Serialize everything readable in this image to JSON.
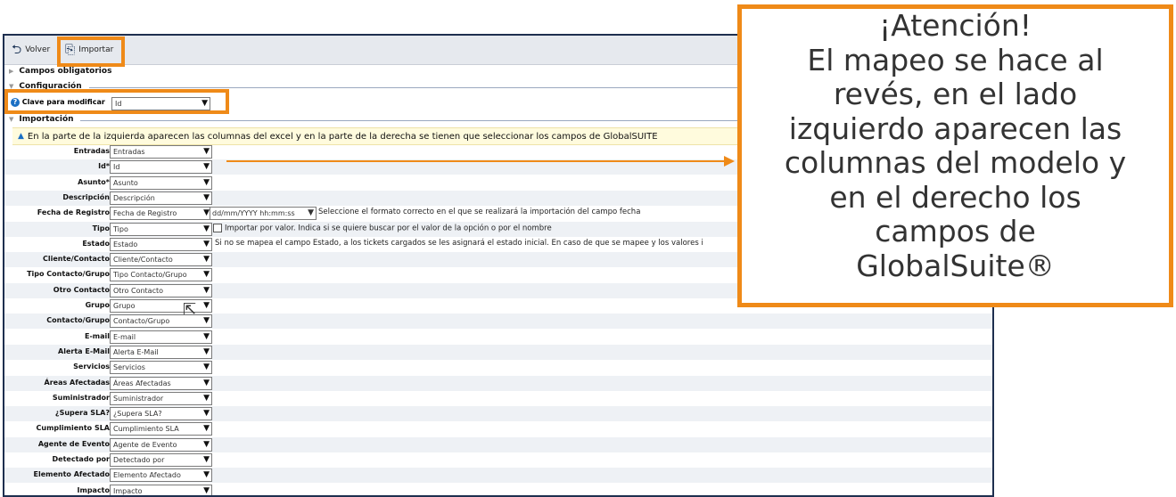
{
  "toolbar": {
    "back_label": "Volver",
    "import_label": "Importar"
  },
  "sections": {
    "required": "Campos obligatorios",
    "config": "Configuración",
    "import": "Importación"
  },
  "config": {
    "key_label": "Clave para modificar",
    "key_value": "Id"
  },
  "info_text": "En la parte de la izquierda aparecen las columnas del excel y en la parte de la derecha se tienen que seleccionar los campos de GlobalSUITE",
  "rows": [
    {
      "label": "Entradas",
      "value": "Entradas"
    },
    {
      "label": "Id*",
      "value": "Id"
    },
    {
      "label": "Asunto*",
      "value": "Asunto"
    },
    {
      "label": "Descripción",
      "value": "Descripción"
    },
    {
      "label": "Fecha de Registro",
      "value": "Fecha de Registro",
      "date_format": "dd/mm/YYYY hh:mm:ss",
      "note": "Seleccione el formato correcto en el que se realizará la importación del campo fecha"
    },
    {
      "label": "Tipo",
      "value": "Tipo",
      "checkbox_note": "Importar por valor. Indica si se quiere buscar por el valor de la opción o por el nombre"
    },
    {
      "label": "Estado",
      "value": "Estado",
      "note": "Si no se mapea el campo Estado, a los tickets cargados se les asignará el estado inicial. En caso de que se mapee y los valores i"
    },
    {
      "label": "Cliente/Contacto",
      "value": "Cliente/Contacto"
    },
    {
      "label": "Tipo Contacto/Grupo",
      "value": "Tipo Contacto/Grupo"
    },
    {
      "label": "Otro Contacto",
      "value": "Otro Contacto"
    },
    {
      "label": "Grupo",
      "value": "Grupo"
    },
    {
      "label": "Contacto/Grupo",
      "value": "Contacto/Grupo"
    },
    {
      "label": "E-mail",
      "value": "E-mail"
    },
    {
      "label": "Alerta E-Mail",
      "value": "Alerta E-Mail"
    },
    {
      "label": "Servicios",
      "value": "Servicios"
    },
    {
      "label": "Áreas Afectadas",
      "value": "Áreas Afectadas"
    },
    {
      "label": "Suministrador",
      "value": "Suministrador"
    },
    {
      "label": "¿Supera SLA?",
      "value": "¿Supera SLA?"
    },
    {
      "label": "Cumplimiento SLA",
      "value": "Cumplimiento SLA"
    },
    {
      "label": "Agente de Evento",
      "value": "Agente de Evento"
    },
    {
      "label": "Detectado por",
      "value": "Detectado por"
    },
    {
      "label": "Elemento Afectado",
      "value": "Elemento Afectado"
    },
    {
      "label": "Impacto",
      "value": "Impacto"
    }
  ],
  "callout": {
    "lines": [
      "¡Atención!",
      "El mapeo se hace al",
      "revés, en el lado",
      "izquierdo aparecen las",
      "columnas del modelo y",
      "en el derecho los",
      "campos de",
      "GlobalSuite®"
    ]
  },
  "colors": {
    "accent": "#ef8a18",
    "frame": "#1e2f4f"
  },
  "icons": {
    "back": "undo-arrow-icon",
    "import": "import-icon",
    "help": "help-icon",
    "info": "info-icon"
  }
}
